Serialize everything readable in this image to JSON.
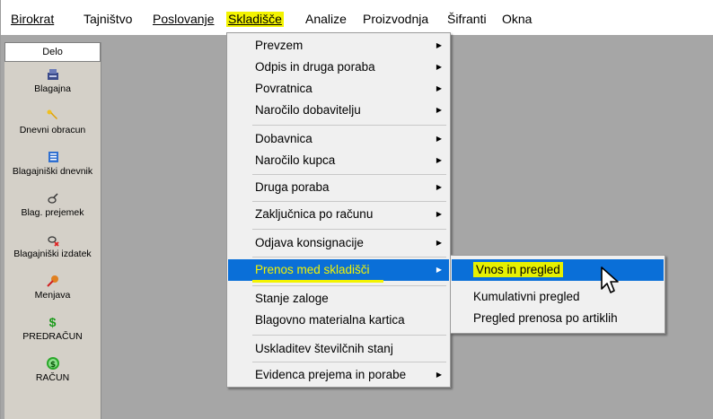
{
  "menubar": {
    "items": [
      {
        "label": "Birokrat"
      },
      {
        "label": "Tajništvo"
      },
      {
        "label": "Poslovanje"
      },
      {
        "label": "Skladišče"
      },
      {
        "label": "Analize"
      },
      {
        "label": "Proizvodnja"
      },
      {
        "label": "Šifranti"
      },
      {
        "label": "Okna"
      }
    ],
    "active": "Skladišče"
  },
  "sidebar": {
    "header": "Delo",
    "items": [
      {
        "label": "Blagajna",
        "icon": "cash-register-icon"
      },
      {
        "label": "Dnevni obracun",
        "icon": "wrench-icon"
      },
      {
        "label": "Blagajniški dnevnik",
        "icon": "ledger-icon"
      },
      {
        "label": "Blag. prejemek",
        "icon": "receipt-in-icon"
      },
      {
        "label": "Blagajniški izdatek",
        "icon": "receipt-out-icon"
      },
      {
        "label": "Menjava",
        "icon": "exchange-icon"
      },
      {
        "label": "PREDRAČUN",
        "icon": "dollar-icon"
      },
      {
        "label": "RAČUN",
        "icon": "dollar-coin-icon"
      }
    ]
  },
  "dropdown": {
    "items": [
      {
        "label": "Prevzem",
        "submenu": true
      },
      {
        "label": "Odpis in druga poraba",
        "submenu": true
      },
      {
        "label": "Povratnica",
        "submenu": true
      },
      {
        "label": "Naročilo dobavitelju",
        "submenu": true
      },
      {
        "label": "Dobavnica",
        "submenu": true
      },
      {
        "label": "Naročilo kupca",
        "submenu": true
      },
      {
        "label": "Druga poraba",
        "submenu": true
      },
      {
        "label": "Zaključnica po računu",
        "submenu": true
      },
      {
        "label": "Odjava konsignacije",
        "submenu": true
      },
      {
        "label": "Prenos med skladišči",
        "submenu": true
      },
      {
        "label": "Stanje zaloge",
        "submenu": false
      },
      {
        "label": "Blagovno materialna kartica",
        "submenu": false
      },
      {
        "label": "Uskladitev številčnih stanj",
        "submenu": false
      },
      {
        "label": "Evidenca prejema in porabe",
        "submenu": true
      }
    ],
    "highlighted": "Prenos med skladišči"
  },
  "submenu": {
    "items": [
      {
        "label": "Vnos in pregled"
      },
      {
        "label": "Kumulativni pregled"
      },
      {
        "label": "Pregled prenosa po artiklih"
      }
    ],
    "highlighted": "Vnos in pregled"
  },
  "colors": {
    "highlight_yellow": "#f3f300",
    "selection_blue": "#0a6fd8",
    "workspace_gray": "#a6a6a6",
    "menu_bg": "#f0f0f0"
  }
}
